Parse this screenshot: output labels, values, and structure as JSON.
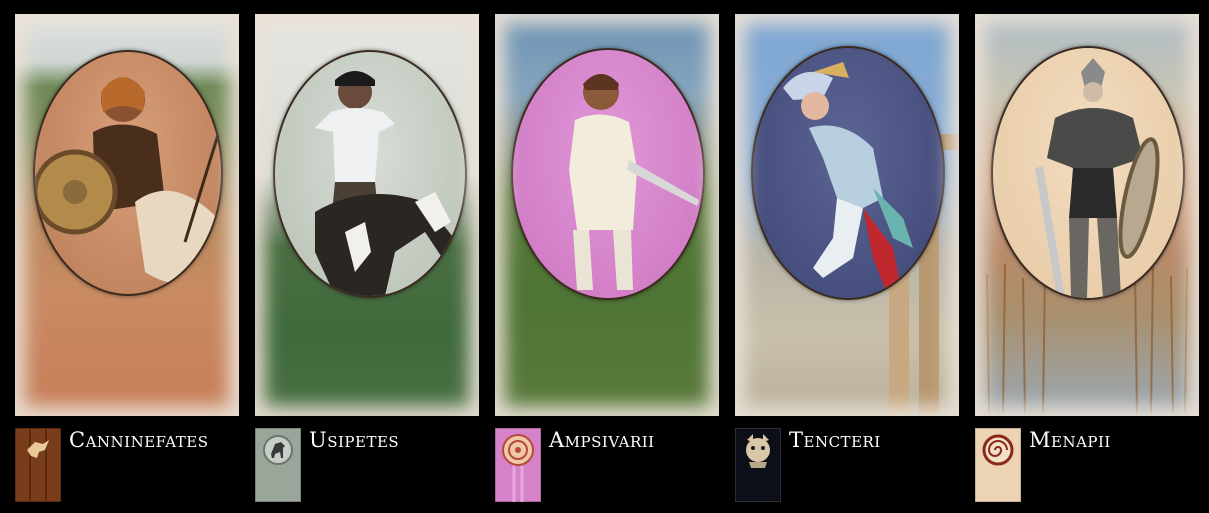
{
  "factions": [
    {
      "name": "Canninefates",
      "banner_color": "#7a3d1a",
      "banner_icon": "horse-rider-icon"
    },
    {
      "name": "Usipetes",
      "banner_color": "#9aa69a",
      "banner_icon": "horse-icon"
    },
    {
      "name": "Ampsivarii",
      "banner_color": "#d682c8",
      "banner_icon": "ring-icon"
    },
    {
      "name": "Tencteri",
      "banner_color": "#0d0f18",
      "banner_icon": "beast-icon"
    },
    {
      "name": "Menapii",
      "banner_color": "#ecd3b4",
      "banner_icon": "spiral-icon"
    }
  ]
}
